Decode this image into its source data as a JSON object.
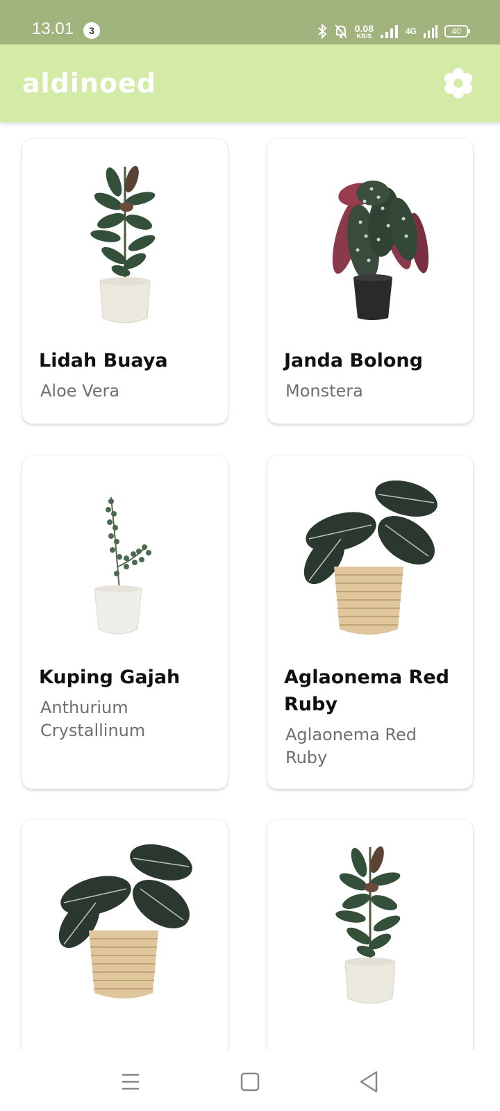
{
  "status_bar": {
    "time": "13.01",
    "notification_count": "3",
    "speed_value": "0.08",
    "speed_unit": "KB/S",
    "network_type": "4G",
    "battery_level": "40"
  },
  "app_bar": {
    "title": "aldinoed",
    "settings_icon": "gear-icon"
  },
  "plants": [
    {
      "name": "Lidah Buaya",
      "latin": "Aloe Vera",
      "image": "rubber-plant-white-pot"
    },
    {
      "name": "Janda Bolong",
      "latin": "Monstera",
      "image": "begonia-black-pot"
    },
    {
      "name": "Kuping Gajah",
      "latin": "Anthurium Crystallinum",
      "image": "eucalyptus-white-pot"
    },
    {
      "name": "Aglaonema Red Ruby",
      "latin": "Aglaonema Red Ruby",
      "image": "alocasia-striped-basket"
    },
    {
      "name": "",
      "latin": "",
      "image": "alocasia-striped-basket"
    },
    {
      "name": "",
      "latin": "",
      "image": "rubber-plant-white-pot"
    }
  ],
  "colors": {
    "status_bar": "#a2b47d",
    "app_bar": "#d4eba8",
    "title_text": "#ffffff"
  },
  "nav_bar": {
    "menu_icon": "menu-icon",
    "home_icon": "home-icon",
    "back_icon": "back-icon"
  }
}
